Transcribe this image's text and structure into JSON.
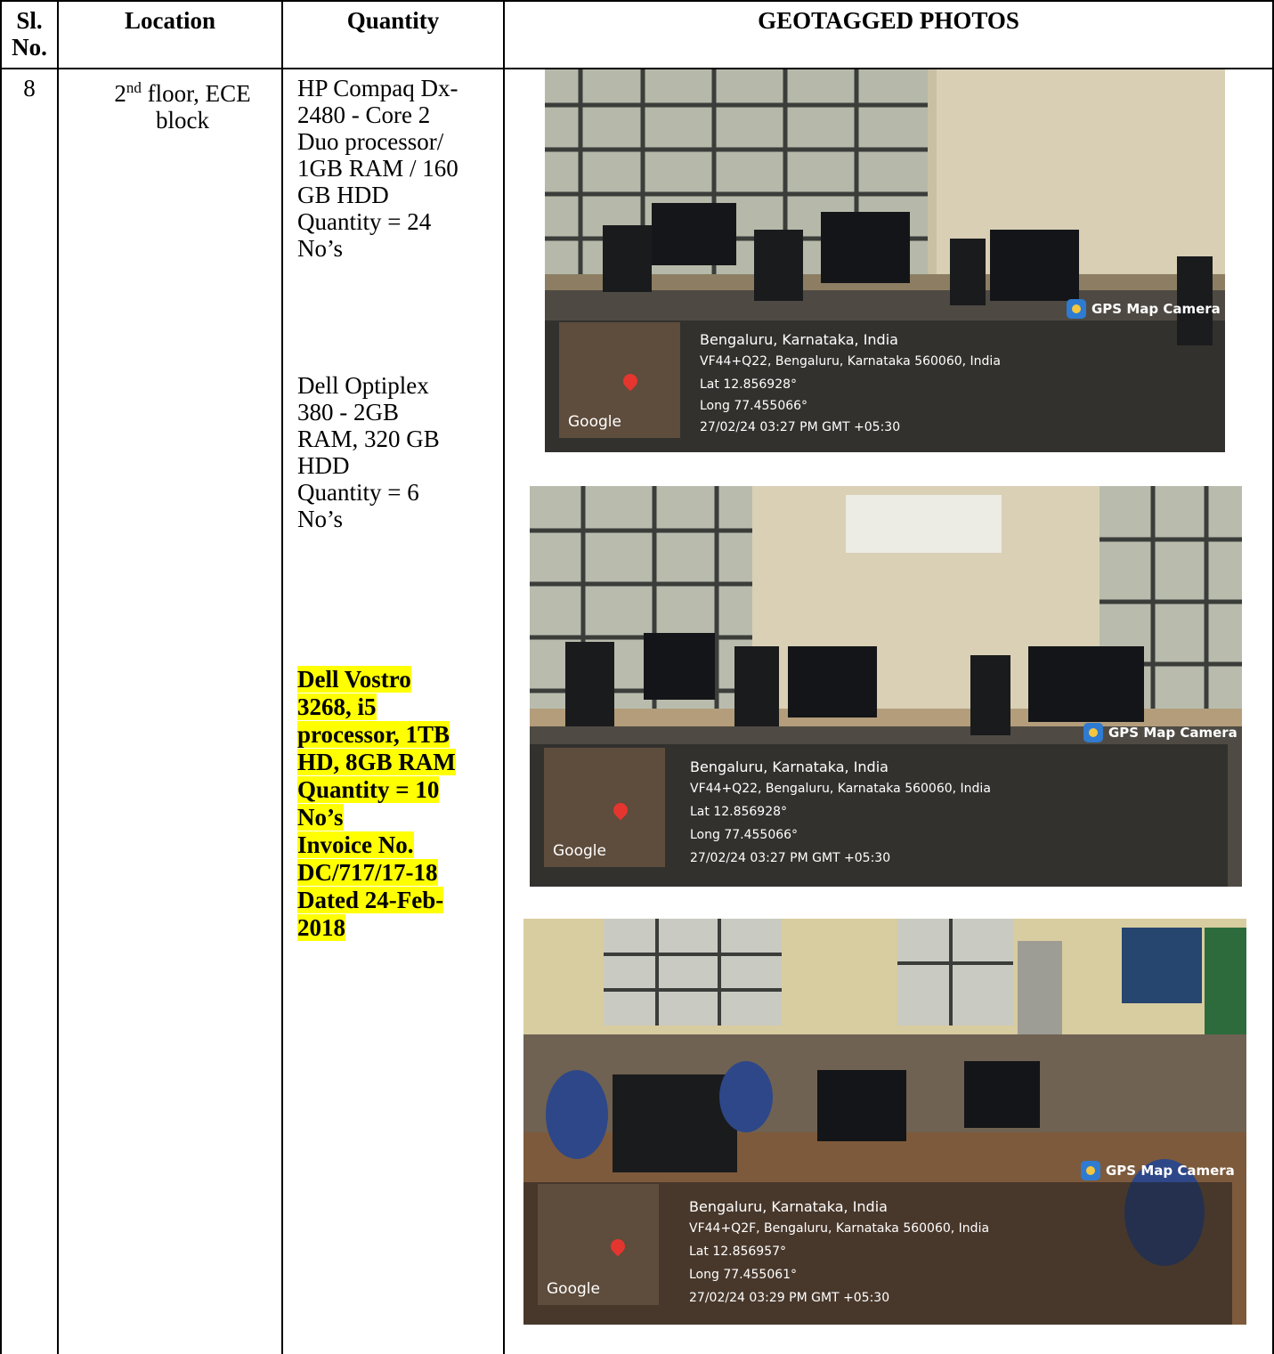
{
  "headers": {
    "sl_no": "Sl. No.",
    "location": "Location",
    "quantity": "Quantity",
    "photos": "GEOTAGGED PHOTOS"
  },
  "row": {
    "sl_no": "8",
    "location_ordinal": "2",
    "location_sup": "nd",
    "location_rest": "floor, ECE block",
    "items": [
      {
        "desc_lines": [
          "HP Compaq Dx-",
          "2480 - Core 2",
          "Duo processor/",
          "1GB RAM / 160",
          "GB HDD",
          "Quantity = 24",
          "No’s"
        ]
      },
      {
        "desc_lines": [
          "Dell Optiplex",
          "380 - 2GB",
          "RAM, 320 GB",
          "HDD",
          "Quantity = 6",
          "No’s"
        ]
      },
      {
        "highlighted": true,
        "desc_lines": [
          "Dell Vostro",
          "3268, i5",
          "processor, 1TB",
          "HD, 8GB RAM",
          "Quantity = 10",
          "No’s",
          "Invoice No.",
          "DC/717/17-18",
          "Dated 24-Feb-",
          "2018"
        ]
      }
    ]
  },
  "photos": [
    {
      "badge": "GPS Map Camera",
      "google": "Google",
      "place": "Bengaluru, Karnataka, India",
      "address": "VF44+Q22, Bengaluru, Karnataka 560060, India",
      "lat": "Lat 12.856928°",
      "long": "Long 77.455066°",
      "datetime": "27/02/24 03:27 PM GMT +05:30"
    },
    {
      "badge": "GPS Map Camera",
      "google": "Google",
      "place": "Bengaluru, Karnataka, India",
      "address": "VF44+Q22, Bengaluru, Karnataka 560060, India",
      "lat": "Lat 12.856928°",
      "long": "Long 77.455066°",
      "datetime": "27/02/24 03:27 PM GMT +05:30"
    },
    {
      "badge": "GPS Map Camera",
      "google": "Google",
      "place": "Bengaluru, Karnataka, India",
      "address": "VF44+Q2F, Bengaluru, Karnataka 560060, India",
      "lat": "Lat 12.856957°",
      "long": "Long 77.455061°",
      "datetime": "27/02/24 03:29 PM GMT +05:30"
    }
  ]
}
